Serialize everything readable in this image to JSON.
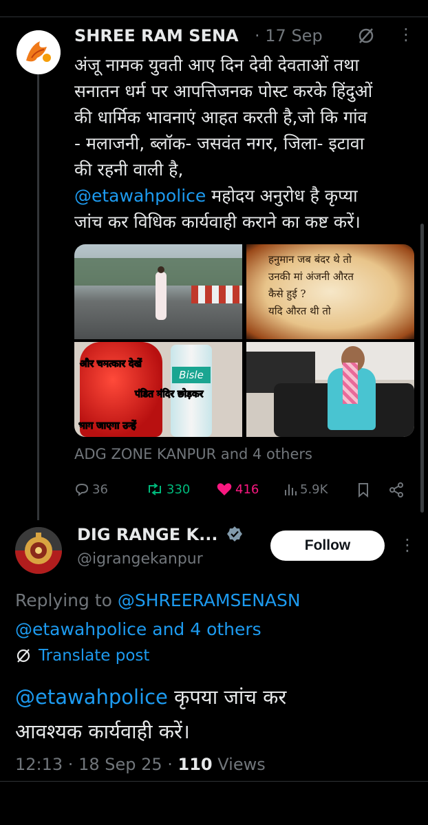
{
  "tweet": {
    "author": "SHREE RAM SENA",
    "separator": "·",
    "date": "17 Sep",
    "text_lines": [
      "अंजू नामक युवती आए दिन देवी देवताओं तथा",
      "सनातन धर्म पर आपत्तिजनक पोस्ट करके हिंदुओं",
      "की धार्मिक भावनाएं आहत करती है,जो कि गांव",
      "- मलाजनी, ब्लॉक- जसवंत नगर, जिला- इटावा",
      "की रहनी वाली है,"
    ],
    "mention": "@etawahpolice",
    "mention_rest": " महोदय अनुरोध है कृप्या",
    "last_line": "जांच कर विधिक कार्यवाही कराने का कष्ट करें।",
    "media": {
      "top_right_lines": [
        "हनुमान जब बंदर थे तो",
        "उनकी मां अंजनी औरत",
        "कैसे हुई ?",
        "यदि औरत थी तो"
      ],
      "bottom_left_caption1": "और चमत्कार देखें",
      "bottom_left_caption2": "पंडित मंदिर छोड़कर",
      "bottom_left_caption3": "भाग जाएगा उन्हें",
      "bottle_label": "Bisle"
    },
    "tagged": "ADG ZONE KANPUR and 4 others",
    "stats": {
      "replies": "36",
      "reposts": "330",
      "likes": "416",
      "views": "5.9K"
    },
    "colors": {
      "like": "#f91880",
      "repost": "#00ba7c",
      "link": "#1d9bf0"
    }
  },
  "reply": {
    "author": "DIG RANGE K...",
    "handle": "@igrangekanpur",
    "follow_label": "Follow",
    "replying_prefix": "Replying to ",
    "replying_to": "@SHREERAMSENASN",
    "replying_line2": "@etawahpolice and 4 others",
    "translate_label": "Translate post",
    "mention": "@etawahpolice",
    "text_rest": " कृपया जांच कर",
    "text_line2": "आवश्यक कार्यवाही करें।",
    "time": "12:13",
    "date": "18 Sep 25",
    "dot": " · ",
    "views_count": "110",
    "views_label": " Views"
  }
}
